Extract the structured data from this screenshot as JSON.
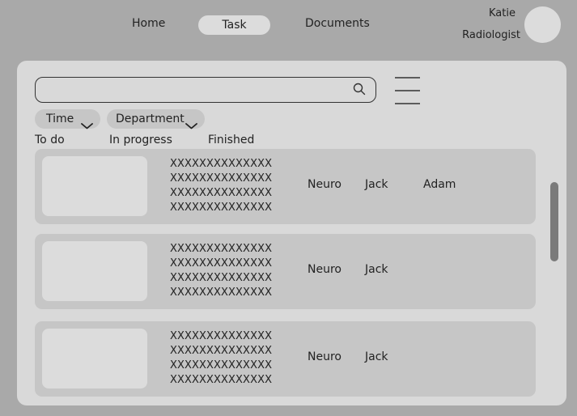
{
  "nav": {
    "home": "Home",
    "task": "Task",
    "documents": "Documents"
  },
  "user": {
    "name": "Katie",
    "role": "Radiologist"
  },
  "search": {
    "value": "",
    "placeholder": ""
  },
  "filters": {
    "time": "Time",
    "department": "Department"
  },
  "tabs": {
    "todo": "To do",
    "in_progress": "In progress",
    "finished": "Finished"
  },
  "tasks": [
    {
      "lines": [
        "XXXXXXXXXXXXXX",
        "XXXXXXXXXXXXXX",
        "XXXXXXXXXXXXXX",
        "XXXXXXXXXXXXXX"
      ],
      "department": "Neuro",
      "doctor": "Jack",
      "assignee": "Adam"
    },
    {
      "lines": [
        "XXXXXXXXXXXXXX",
        "XXXXXXXXXXXXXX",
        "XXXXXXXXXXXXXX",
        "XXXXXXXXXXXXXX"
      ],
      "department": "Neuro",
      "doctor": "Jack",
      "assignee": ""
    },
    {
      "lines": [
        "XXXXXXXXXXXXXX",
        "XXXXXXXXXXXXXX",
        "XXXXXXXXXXXXXX",
        "XXXXXXXXXXXXXX"
      ],
      "department": "Neuro",
      "doctor": "Jack",
      "assignee": ""
    }
  ],
  "colors": {
    "background": "#a9a9a9",
    "panel": "#d9d9d9",
    "card": "#c6c6c6",
    "scrollbar": "#7a7a7a"
  },
  "icons": {
    "search": "search-icon",
    "menu": "menu-icon",
    "chevron": "chevron-down-icon"
  }
}
